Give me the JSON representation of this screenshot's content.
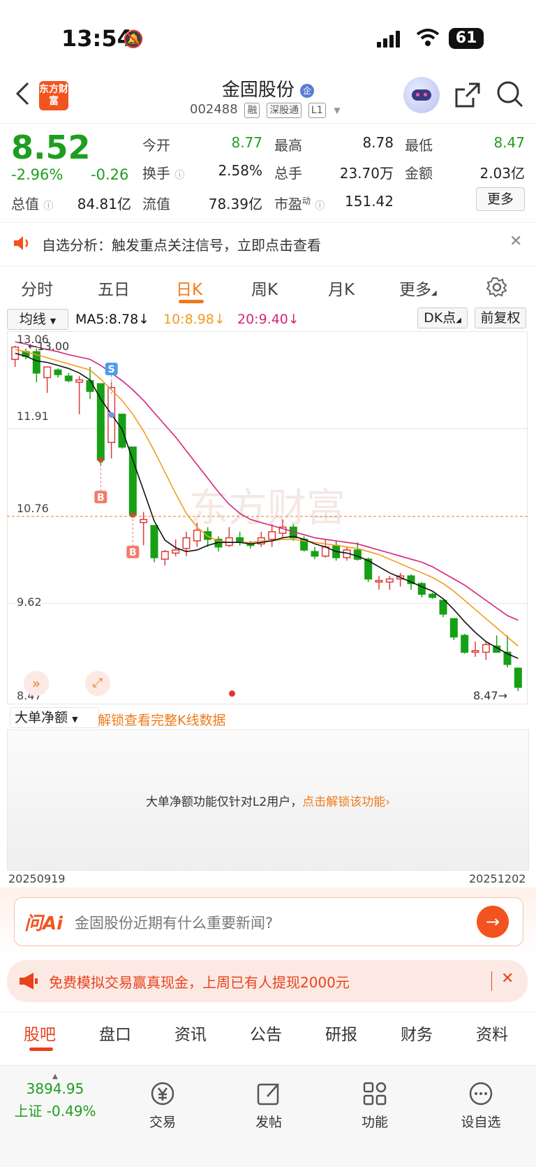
{
  "status_bar": {
    "time": "13:54",
    "battery": "61"
  },
  "header": {
    "logo_text": "东方财富",
    "stock_name": "金固股份",
    "stock_badge": "企",
    "stock_code": "002488",
    "tags": [
      "融",
      "深股通",
      "L1"
    ]
  },
  "quote": {
    "price": "8.52",
    "change_pct": "-2.96%",
    "change": "-0.26",
    "total_value_label": "总值",
    "total_value": "84.81亿",
    "open_label": "今开",
    "open": "8.77",
    "high_label": "最高",
    "high": "8.78",
    "low_label": "最低",
    "low": "8.47",
    "turnover_label": "换手",
    "turnover": "2.58%",
    "volume_label": "总手",
    "volume": "23.70万",
    "amount_label": "金额",
    "amount": "2.03亿",
    "float_label": "流值",
    "float_value": "78.39亿",
    "pe_label": "市盈",
    "pe_sup": "动",
    "pe": "151.42",
    "more_button": "更多"
  },
  "notice": {
    "text": "自选分析：触发重点关注信号，立即点击查看"
  },
  "kline_tabs": [
    {
      "label": "分时",
      "active": false
    },
    {
      "label": "五日",
      "active": false
    },
    {
      "label": "日K",
      "active": true
    },
    {
      "label": "周K",
      "active": false
    },
    {
      "label": "月K",
      "active": false
    },
    {
      "label": "更多",
      "active": false
    }
  ],
  "ma_bar": {
    "selector": "均线",
    "ma5": "MA5:8.78",
    "ma10": "10:8.98",
    "ma20": "20:9.40",
    "dk_button": "DK点",
    "adjust_button": "前复权"
  },
  "chart_labels": {
    "y_ticks": [
      "13.06",
      "11.91",
      "10.76",
      "9.62",
      "8.47"
    ],
    "max_marker": "13.00",
    "min_marker": "8.47",
    "watermark": "东方财富",
    "buy_marker": "B",
    "sell_marker": "S"
  },
  "chart_data": {
    "type": "candlestick",
    "ylim": [
      8.47,
      13.06
    ],
    "ref_price": 10.76,
    "candles": [
      {
        "o": 12.82,
        "h": 13.0,
        "l": 12.72,
        "c": 12.98
      },
      {
        "o": 12.92,
        "h": 12.96,
        "l": 12.82,
        "c": 12.86
      },
      {
        "o": 12.92,
        "h": 12.96,
        "l": 12.52,
        "c": 12.64
      },
      {
        "o": 12.58,
        "h": 12.72,
        "l": 12.38,
        "c": 12.72
      },
      {
        "o": 12.68,
        "h": 12.7,
        "l": 12.58,
        "c": 12.62
      },
      {
        "o": 12.6,
        "h": 12.64,
        "l": 12.52,
        "c": 12.54
      },
      {
        "o": 12.52,
        "h": 12.6,
        "l": 12.1,
        "c": 12.55
      },
      {
        "o": 12.54,
        "h": 12.72,
        "l": 12.3,
        "c": 12.4
      },
      {
        "o": 12.5,
        "h": 12.5,
        "l": 11.42,
        "c": 11.5
      },
      {
        "o": 11.73,
        "h": 12.52,
        "l": 11.52,
        "c": 12.45
      },
      {
        "o": 12.1,
        "h": 12.1,
        "l": 11.65,
        "c": 11.67
      },
      {
        "o": 11.67,
        "h": 11.67,
        "l": 10.76,
        "c": 10.78
      },
      {
        "o": 10.68,
        "h": 10.82,
        "l": 10.38,
        "c": 10.72
      },
      {
        "o": 10.64,
        "h": 10.64,
        "l": 10.16,
        "c": 10.22
      },
      {
        "o": 10.2,
        "h": 10.32,
        "l": 10.12,
        "c": 10.3
      },
      {
        "o": 10.28,
        "h": 10.46,
        "l": 10.24,
        "c": 10.32
      },
      {
        "o": 10.34,
        "h": 10.56,
        "l": 10.24,
        "c": 10.48
      },
      {
        "o": 10.44,
        "h": 10.68,
        "l": 10.36,
        "c": 10.58
      },
      {
        "o": 10.56,
        "h": 10.62,
        "l": 10.36,
        "c": 10.46
      },
      {
        "o": 10.46,
        "h": 10.5,
        "l": 10.3,
        "c": 10.36
      },
      {
        "o": 10.38,
        "h": 10.62,
        "l": 10.36,
        "c": 10.48
      },
      {
        "o": 10.48,
        "h": 10.56,
        "l": 10.38,
        "c": 10.42
      },
      {
        "o": 10.4,
        "h": 10.44,
        "l": 10.34,
        "c": 10.38
      },
      {
        "o": 10.4,
        "h": 10.56,
        "l": 10.36,
        "c": 10.48
      },
      {
        "o": 10.46,
        "h": 10.66,
        "l": 10.36,
        "c": 10.56
      },
      {
        "o": 10.54,
        "h": 10.72,
        "l": 10.48,
        "c": 10.62
      },
      {
        "o": 10.62,
        "h": 10.66,
        "l": 10.44,
        "c": 10.48
      },
      {
        "o": 10.46,
        "h": 10.5,
        "l": 10.3,
        "c": 10.32
      },
      {
        "o": 10.3,
        "h": 10.36,
        "l": 10.2,
        "c": 10.24
      },
      {
        "o": 10.24,
        "h": 10.46,
        "l": 10.22,
        "c": 10.36
      },
      {
        "o": 10.38,
        "h": 10.44,
        "l": 10.18,
        "c": 10.22
      },
      {
        "o": 10.22,
        "h": 10.36,
        "l": 10.18,
        "c": 10.32
      },
      {
        "o": 10.32,
        "h": 10.42,
        "l": 10.18,
        "c": 10.2
      },
      {
        "o": 10.2,
        "h": 10.22,
        "l": 9.9,
        "c": 9.94
      },
      {
        "o": 9.9,
        "h": 9.98,
        "l": 9.8,
        "c": 9.92
      },
      {
        "o": 9.9,
        "h": 9.98,
        "l": 9.8,
        "c": 9.94
      },
      {
        "o": 9.94,
        "h": 10.02,
        "l": 9.84,
        "c": 9.98
      },
      {
        "o": 9.98,
        "h": 10.0,
        "l": 9.8,
        "c": 9.88
      },
      {
        "o": 9.88,
        "h": 9.9,
        "l": 9.7,
        "c": 9.74
      },
      {
        "o": 9.74,
        "h": 9.76,
        "l": 9.68,
        "c": 9.7
      },
      {
        "o": 9.66,
        "h": 9.66,
        "l": 9.44,
        "c": 9.48
      },
      {
        "o": 9.42,
        "h": 9.42,
        "l": 9.14,
        "c": 9.18
      },
      {
        "o": 9.2,
        "h": 9.22,
        "l": 8.96,
        "c": 8.98
      },
      {
        "o": 8.98,
        "h": 9.12,
        "l": 8.92,
        "c": 9.0
      },
      {
        "o": 8.98,
        "h": 9.12,
        "l": 8.88,
        "c": 9.08
      },
      {
        "o": 9.06,
        "h": 9.2,
        "l": 8.98,
        "c": 8.98
      },
      {
        "o": 8.98,
        "h": 9.2,
        "l": 8.78,
        "c": 8.82
      },
      {
        "o": 8.77,
        "h": 8.78,
        "l": 8.47,
        "c": 8.52
      }
    ],
    "ma5": [
      12.9,
      12.86,
      12.8,
      12.78,
      12.74,
      12.7,
      12.64,
      12.55,
      12.3,
      12.1,
      11.9,
      11.5,
      11.1,
      10.7,
      10.45,
      10.35,
      10.3,
      10.32,
      10.38,
      10.42,
      10.42,
      10.42,
      10.4,
      10.42,
      10.44,
      10.48,
      10.5,
      10.46,
      10.4,
      10.36,
      10.3,
      10.28,
      10.24,
      10.18,
      10.1,
      10.02,
      9.96,
      9.9,
      9.84,
      9.78,
      9.68,
      9.54,
      9.38,
      9.24,
      9.12,
      9.04,
      8.96,
      8.9
    ],
    "ma10": [
      12.95,
      12.92,
      12.88,
      12.84,
      12.8,
      12.76,
      12.72,
      12.68,
      12.56,
      12.42,
      12.28,
      12.1,
      11.88,
      11.62,
      11.34,
      11.06,
      10.8,
      10.62,
      10.5,
      10.44,
      10.42,
      10.42,
      10.42,
      10.44,
      10.44,
      10.46,
      10.46,
      10.44,
      10.42,
      10.4,
      10.38,
      10.36,
      10.34,
      10.3,
      10.26,
      10.2,
      10.14,
      10.08,
      10.02,
      9.96,
      9.88,
      9.78,
      9.66,
      9.54,
      9.42,
      9.3,
      9.18,
      9.06
    ],
    "ma20": [
      13.05,
      13.02,
      12.98,
      12.95,
      12.92,
      12.88,
      12.85,
      12.82,
      12.74,
      12.64,
      12.54,
      12.42,
      12.28,
      12.12,
      11.96,
      11.8,
      11.62,
      11.44,
      11.26,
      11.08,
      10.92,
      10.8,
      10.72,
      10.68,
      10.64,
      10.6,
      10.56,
      10.52,
      10.48,
      10.46,
      10.44,
      10.42,
      10.4,
      10.36,
      10.32,
      10.28,
      10.24,
      10.2,
      10.16,
      10.1,
      10.02,
      9.94,
      9.86,
      9.76,
      9.66,
      9.56,
      9.46,
      9.4
    ],
    "buy_signals": [
      8,
      11
    ],
    "sell_signals": [
      9
    ]
  },
  "volume_panel": {
    "selector": "大单净额",
    "unlock_link": "解锁查看完整K线数据",
    "message": "大单净额功能仅针对L2用户，",
    "unlock_action": "点击解锁该功能",
    "start_date": "20250919",
    "end_date": "20251202"
  },
  "ai": {
    "brand": "问Ai",
    "placeholder": "金固股份近期有什么重要新闻?"
  },
  "promo": {
    "text": "免费模拟交易赢真现金，上周已有人提现2000元"
  },
  "bottom_tabs": [
    {
      "label": "股吧",
      "active": true
    },
    {
      "label": "盘口",
      "active": false
    },
    {
      "label": "资讯",
      "active": false
    },
    {
      "label": "公告",
      "active": false
    },
    {
      "label": "研报",
      "active": false
    },
    {
      "label": "财务",
      "active": false
    },
    {
      "label": "资料",
      "active": false
    }
  ],
  "bottom_nav": {
    "index_value": "3894.95",
    "index_label": "上证 -0.49%",
    "items": [
      "交易",
      "发帖",
      "功能",
      "设自选"
    ]
  }
}
